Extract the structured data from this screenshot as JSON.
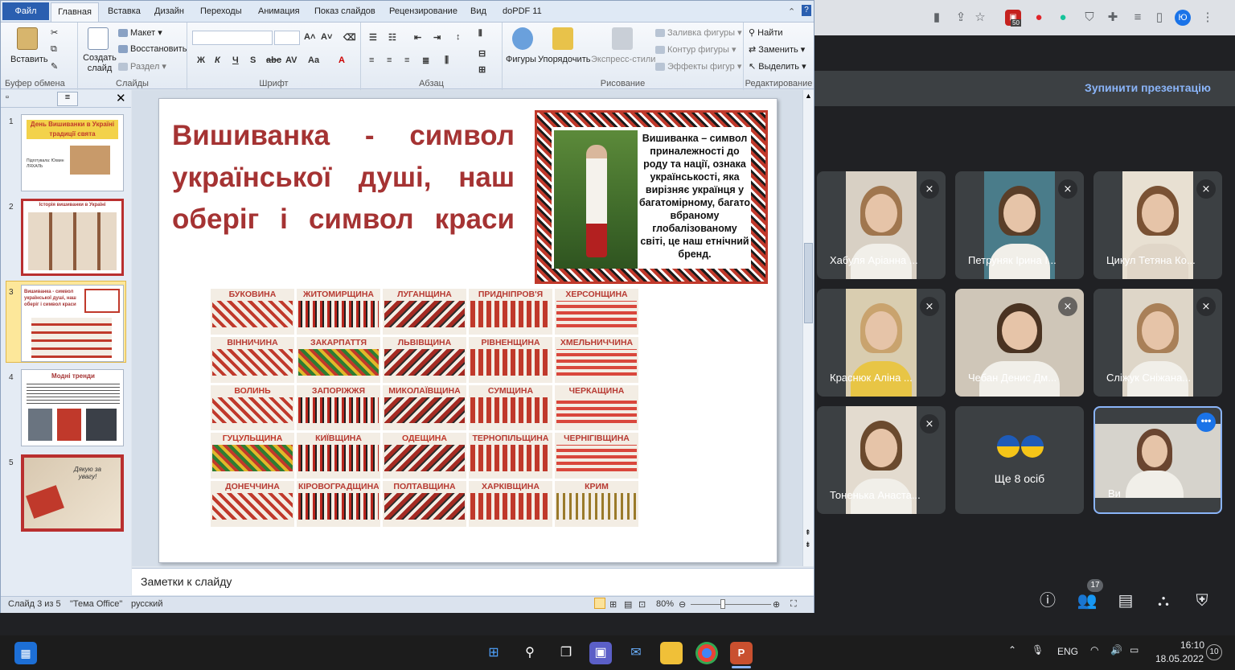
{
  "ppt": {
    "tabs": [
      "Файл",
      "Главная",
      "Вставка",
      "Дизайн",
      "Переходы",
      "Анимация",
      "Показ слайдов",
      "Рецензирование",
      "Вид",
      "doPDF 11"
    ],
    "clipboard": {
      "paste": "Вставить",
      "label": "Буфер обмена"
    },
    "slides_group": {
      "new_slide": "Создать слайд",
      "layout": "Макет",
      "reset": "Восстановить",
      "section": "Раздел",
      "label": "Слайды"
    },
    "font_group": {
      "label": "Шрифт"
    },
    "paragraph_group": {
      "label": "Абзац"
    },
    "drawing": {
      "shapes": "Фигуры",
      "arrange": "Упорядочить",
      "quick_styles": "Экспресс-стили",
      "fill": "Заливка фигуры",
      "outline": "Контур фигуры",
      "effects": "Эффекты фигур",
      "label": "Рисование"
    },
    "editing": {
      "find": "Найти",
      "replace": "Заменить",
      "select": "Выделить",
      "label": "Редактирование"
    },
    "thumbs": [
      {
        "num": "1",
        "title": "День Вишиванки в Україні традиції свята",
        "sub": "Підготувала: Юхвин ЛЯХАЛЬ"
      },
      {
        "num": "2",
        "title": "Історія вишиванки в Україні"
      },
      {
        "num": "3",
        "title": "Вишиванка - символ української душі, наш оберіг і символ краси"
      },
      {
        "num": "4",
        "title": "Модні тренди"
      },
      {
        "num": "5",
        "title": "Дякую за увагу!"
      }
    ],
    "slide": {
      "title": "Вишиванка - символ української душі, наш оберіг і символ краси",
      "info": "Вишиванка – символ приналежності до роду та нації, ознака українськості, яка вирізняє українця у багатомірному, багато вбраному глобалізованому світі, це наш етнічний бренд.",
      "regions": [
        "БУКОВИНА",
        "ЖИТОМИРЩИНА",
        "ЛУГАНЩИНА",
        "ПРИДНІПРОВ'Я",
        "ХЕРСОНЩИНА",
        "ВІННИЧИНА",
        "ЗАКАРПАТТЯ",
        "ЛЬВІВЩИНА",
        "РІВНЕНЩИНА",
        "ХМЕЛЬНИЧЧИНА",
        "ВОЛИНЬ",
        "ЗАПОРІЖЖЯ",
        "МИКОЛАЇВЩИНА",
        "СУМЩИНА",
        "ЧЕРКАЩИНА",
        "ГУЦУЛЬЩИНА",
        "КИЇВЩИНА",
        "ОДЕЩИНА",
        "ТЕРНОПІЛЬЩИНА",
        "ЧЕРНІГІВЩИНА",
        "ДОНЕЧЧИНА",
        "КІРОВОГРАДЩИНА",
        "ПОЛТАВЩИНА",
        "ХАРКІВЩИНА",
        "КРИМ"
      ]
    },
    "notes_placeholder": "Заметки к слайду",
    "status": {
      "slide": "Слайд 3 из 5",
      "theme": "\"Тема Office\"",
      "lang": "русский",
      "zoom": "80%"
    }
  },
  "meet": {
    "stop_presenting": "Зупинити презентацію",
    "participants": [
      {
        "name": "Хабуля Аріанна ..."
      },
      {
        "name": "Петруняк Ірина І..."
      },
      {
        "name": "Цикул Тетяна Ко..."
      },
      {
        "name": "Краснюк Аліна ..."
      },
      {
        "name": "Чебан Денис Дм..."
      },
      {
        "name": "Сліжук Сніжана..."
      },
      {
        "name": "Тоненька Анаста..."
      }
    ],
    "more_people": "Ще 8 осіб",
    "self_name": "Ви",
    "participant_count": "17"
  },
  "chrome": {
    "ext_badge": "50",
    "avatar": "Ю"
  },
  "taskbar": {
    "lang": "ENG",
    "time": "16:10",
    "date": "18.05.2022",
    "notif": "10"
  },
  "colors": {
    "title_red": "#a53333",
    "meet_bg": "#202124",
    "accent_blue": "#8ab4f8",
    "file_tab": "#2a5fb0"
  }
}
